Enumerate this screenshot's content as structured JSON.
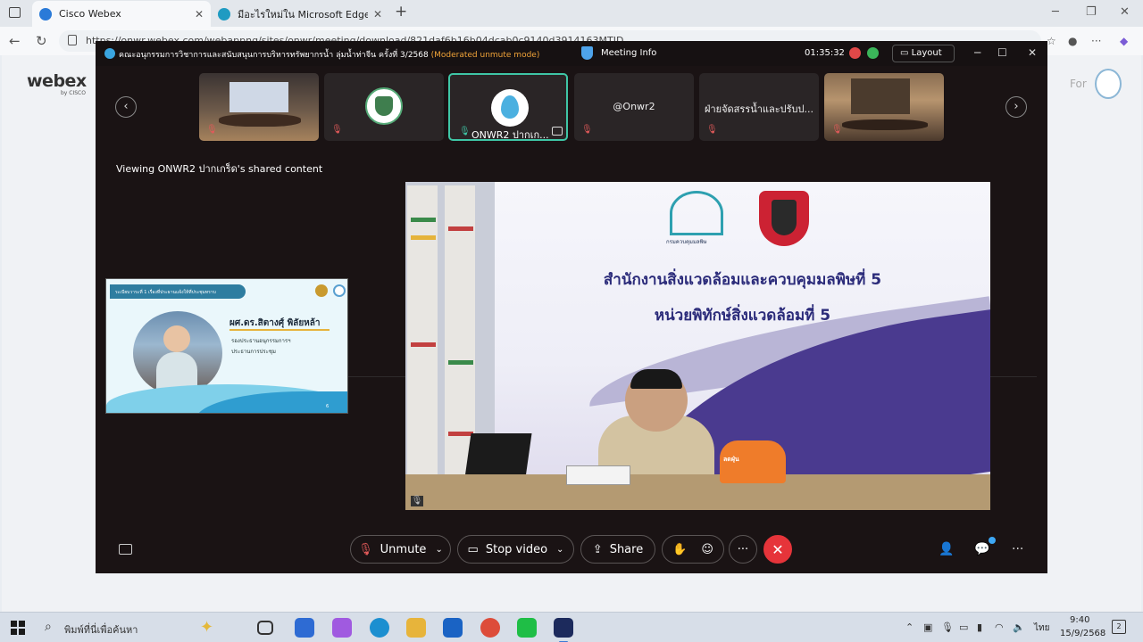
{
  "browser": {
    "tabs": [
      {
        "title": "Cisco Webex",
        "active": true
      },
      {
        "title": "มีอะไรใหม่ใน Microsoft Edge",
        "active": false
      }
    ],
    "new_tab_label": "+",
    "url": "https://onwr.webex.com/webappng/sites/onwr/meeting/download/821daf6b16b04dcab0c9140d3914163MTID..."
  },
  "page": {
    "logo": "webex",
    "logo_sub": "by CISCO",
    "for_text": "For"
  },
  "meeting": {
    "title": "คณะอนุกรรมการวิชาการและสนับสนุนการบริหารทรัพยากรน้ำ ลุ่มน้ำท่าจีน ครั้งที่ 3/2568",
    "mode": "(Moderated unmute mode)",
    "info_label": "Meeting Info",
    "timer": "01:35:32",
    "layout_label": "Layout",
    "viewing_text": "Viewing ONWR2 ปากเกร็ด's shared content",
    "thumbnails": [
      {
        "name": "",
        "kind": "room",
        "muted": true
      },
      {
        "name": "",
        "kind": "seal",
        "muted": true
      },
      {
        "name": "ONWR2 ปากเก...",
        "kind": "drop",
        "muted": false,
        "active": true
      },
      {
        "name": "@Onwr2",
        "kind": "text",
        "muted": true
      },
      {
        "name": "ฝ่ายจัดสรรน้ำและปรับป...",
        "kind": "text",
        "muted": true
      },
      {
        "name": "",
        "kind": "room2",
        "muted": true
      }
    ],
    "self_view": {
      "slide_header": "ระเบียบวาระที่ 1 เรื่องที่ประธานแจ้งให้ที่ประชุมทราบ",
      "person_name": "ผศ.ดร.สิตางศุ์ พิลัยหล้า",
      "role_1": "รองประธานอนุกรรมการฯ",
      "role_2": "ประธานการประชุม",
      "page_no": "6"
    },
    "main_video": {
      "line_1": "สำนักงานสิ่งแวดล้อมและควบคุมมลพิษที่ 5",
      "line_2": "หน่วยพิทักษ์สิ่งแวดล้อมที่ 5",
      "logo_text": "กรมควบคุมมลพิษ",
      "campaign_text": "ลดฝุ่น"
    },
    "controls": {
      "unmute": "Unmute",
      "stop_video": "Stop video",
      "share": "Share",
      "more": "···"
    }
  },
  "taskbar": {
    "search_placeholder": "พิมพ์ที่นี่เพื่อค้นหา",
    "language": "ไทย",
    "time": "9:40",
    "date": "15/9/2568",
    "notification_count": "2"
  }
}
